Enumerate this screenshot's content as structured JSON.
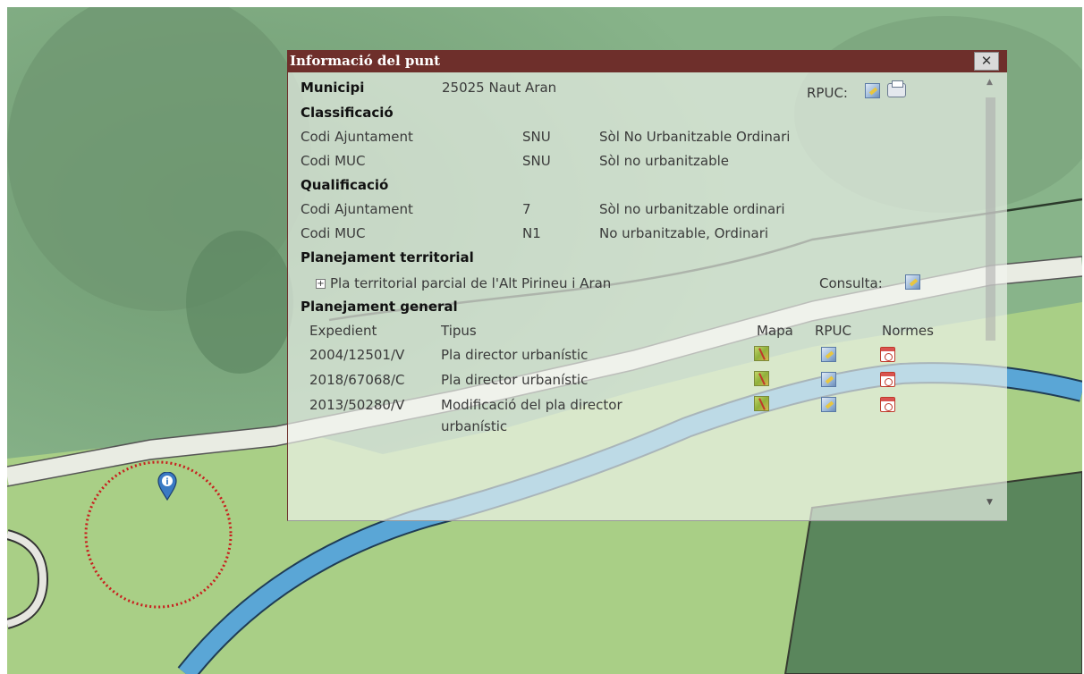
{
  "popup": {
    "title": "Informació del punt",
    "close_symbol": "✕",
    "municipi": {
      "label": "Municipi",
      "value": "25025 Naut Aran",
      "rpuc_label": "RPUC:"
    },
    "classificacio": {
      "heading": "Classificació",
      "rows": [
        {
          "name": "Codi Ajuntament",
          "code": "SNU",
          "desc": "Sòl No Urbanitzable Ordinari"
        },
        {
          "name": "Codi MUC",
          "code": "SNU",
          "desc": "Sòl no urbanitzable"
        }
      ]
    },
    "qualificacio": {
      "heading": "Qualificació",
      "rows": [
        {
          "name": "Codi Ajuntament",
          "code": "7",
          "desc": "Sòl no urbanitzable ordinari"
        },
        {
          "name": "Codi MUC",
          "code": "N1",
          "desc": "No urbanitzable, Ordinari"
        }
      ]
    },
    "planejament_territorial": {
      "heading": "Planejament territorial",
      "item": "Pla territorial parcial de l'Alt Pirineu i Aran",
      "consulta_label": "Consulta:"
    },
    "planejament_general": {
      "heading": "Planejament general",
      "columns": [
        "Expedient",
        "Tipus",
        "Mapa",
        "RPUC",
        "Normes"
      ],
      "rows": [
        {
          "expedient": "2004/12501/V",
          "tipus": "Pla director urbanístic"
        },
        {
          "expedient": "2018/67068/C",
          "tipus": "Pla director urbanístic"
        },
        {
          "expedient": "2013/50280/V",
          "tipus": "Modificació del pla director",
          "tipus_line2": "urbanístic"
        }
      ]
    }
  },
  "icons": {
    "close": "close-icon",
    "rpuc": "rpuc-document-icon",
    "print": "print-icon",
    "expand": "plus-expand-icon",
    "mapa": "map-icon",
    "normes": "pdf-icon",
    "marker": "info-location-marker-icon"
  },
  "colors": {
    "header": "#6e2f2b",
    "river": "#5aa6d6",
    "highlight_circle": "#c81e1e"
  }
}
